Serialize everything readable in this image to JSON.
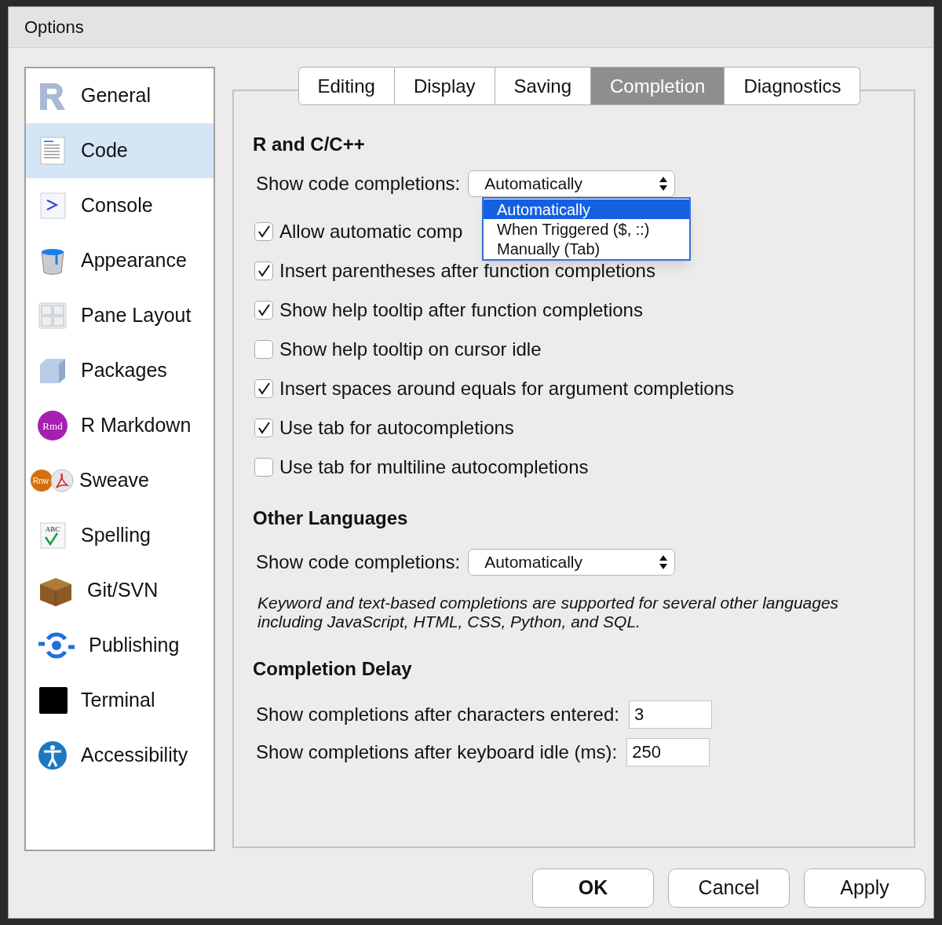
{
  "window": {
    "title": "Options"
  },
  "sidebar": {
    "items": [
      {
        "label": "General",
        "selected": false
      },
      {
        "label": "Code",
        "selected": true
      },
      {
        "label": "Console",
        "selected": false
      },
      {
        "label": "Appearance",
        "selected": false
      },
      {
        "label": "Pane Layout",
        "selected": false
      },
      {
        "label": "Packages",
        "selected": false
      },
      {
        "label": "R Markdown",
        "selected": false,
        "icon_text": "Rmd"
      },
      {
        "label": "Sweave",
        "selected": false,
        "icon_text": "Rnw"
      },
      {
        "label": "Spelling",
        "selected": false,
        "icon_text": "ABC"
      },
      {
        "label": "Git/SVN",
        "selected": false
      },
      {
        "label": "Publishing",
        "selected": false
      },
      {
        "label": "Terminal",
        "selected": false
      },
      {
        "label": "Accessibility",
        "selected": false
      }
    ]
  },
  "tabs": [
    {
      "label": "Editing",
      "selected": false
    },
    {
      "label": "Display",
      "selected": false
    },
    {
      "label": "Saving",
      "selected": false
    },
    {
      "label": "Completion",
      "selected": true
    },
    {
      "label": "Diagnostics",
      "selected": false
    }
  ],
  "r_and_cpp": {
    "heading": "R and C/C++",
    "select": {
      "label": "Show code completions:",
      "value": "Automatically"
    },
    "dropdown_options": [
      {
        "label": "Automatically",
        "selected": true
      },
      {
        "label": "When Triggered ($, ::)",
        "selected": false
      },
      {
        "label": "Manually (Tab)",
        "selected": false
      }
    ],
    "checkboxes": [
      {
        "label": "Allow automatic comp",
        "checked": true
      },
      {
        "label": "Insert parentheses after function completions",
        "checked": true
      },
      {
        "label": "Show help tooltip after function completions",
        "checked": true
      },
      {
        "label": "Show help tooltip on cursor idle",
        "checked": false
      },
      {
        "label": "Insert spaces around equals for argument completions",
        "checked": true
      },
      {
        "label": "Use tab for autocompletions",
        "checked": true
      },
      {
        "label": "Use tab for multiline autocompletions",
        "checked": false
      }
    ]
  },
  "other_languages": {
    "heading": "Other Languages",
    "select": {
      "label": "Show code completions:",
      "value": "Automatically"
    },
    "note": "Keyword and text-based completions are supported for several other languages including JavaScript, HTML, CSS, Python, and SQL."
  },
  "completion_delay": {
    "heading": "Completion Delay",
    "fields": [
      {
        "label": "Show completions after characters entered:",
        "value": "3"
      },
      {
        "label": "Show completions after keyboard idle (ms):",
        "value": "250"
      }
    ]
  },
  "buttons": [
    {
      "label": "OK",
      "default": true
    },
    {
      "label": "Cancel",
      "default": false
    },
    {
      "label": "Apply",
      "default": false
    }
  ]
}
